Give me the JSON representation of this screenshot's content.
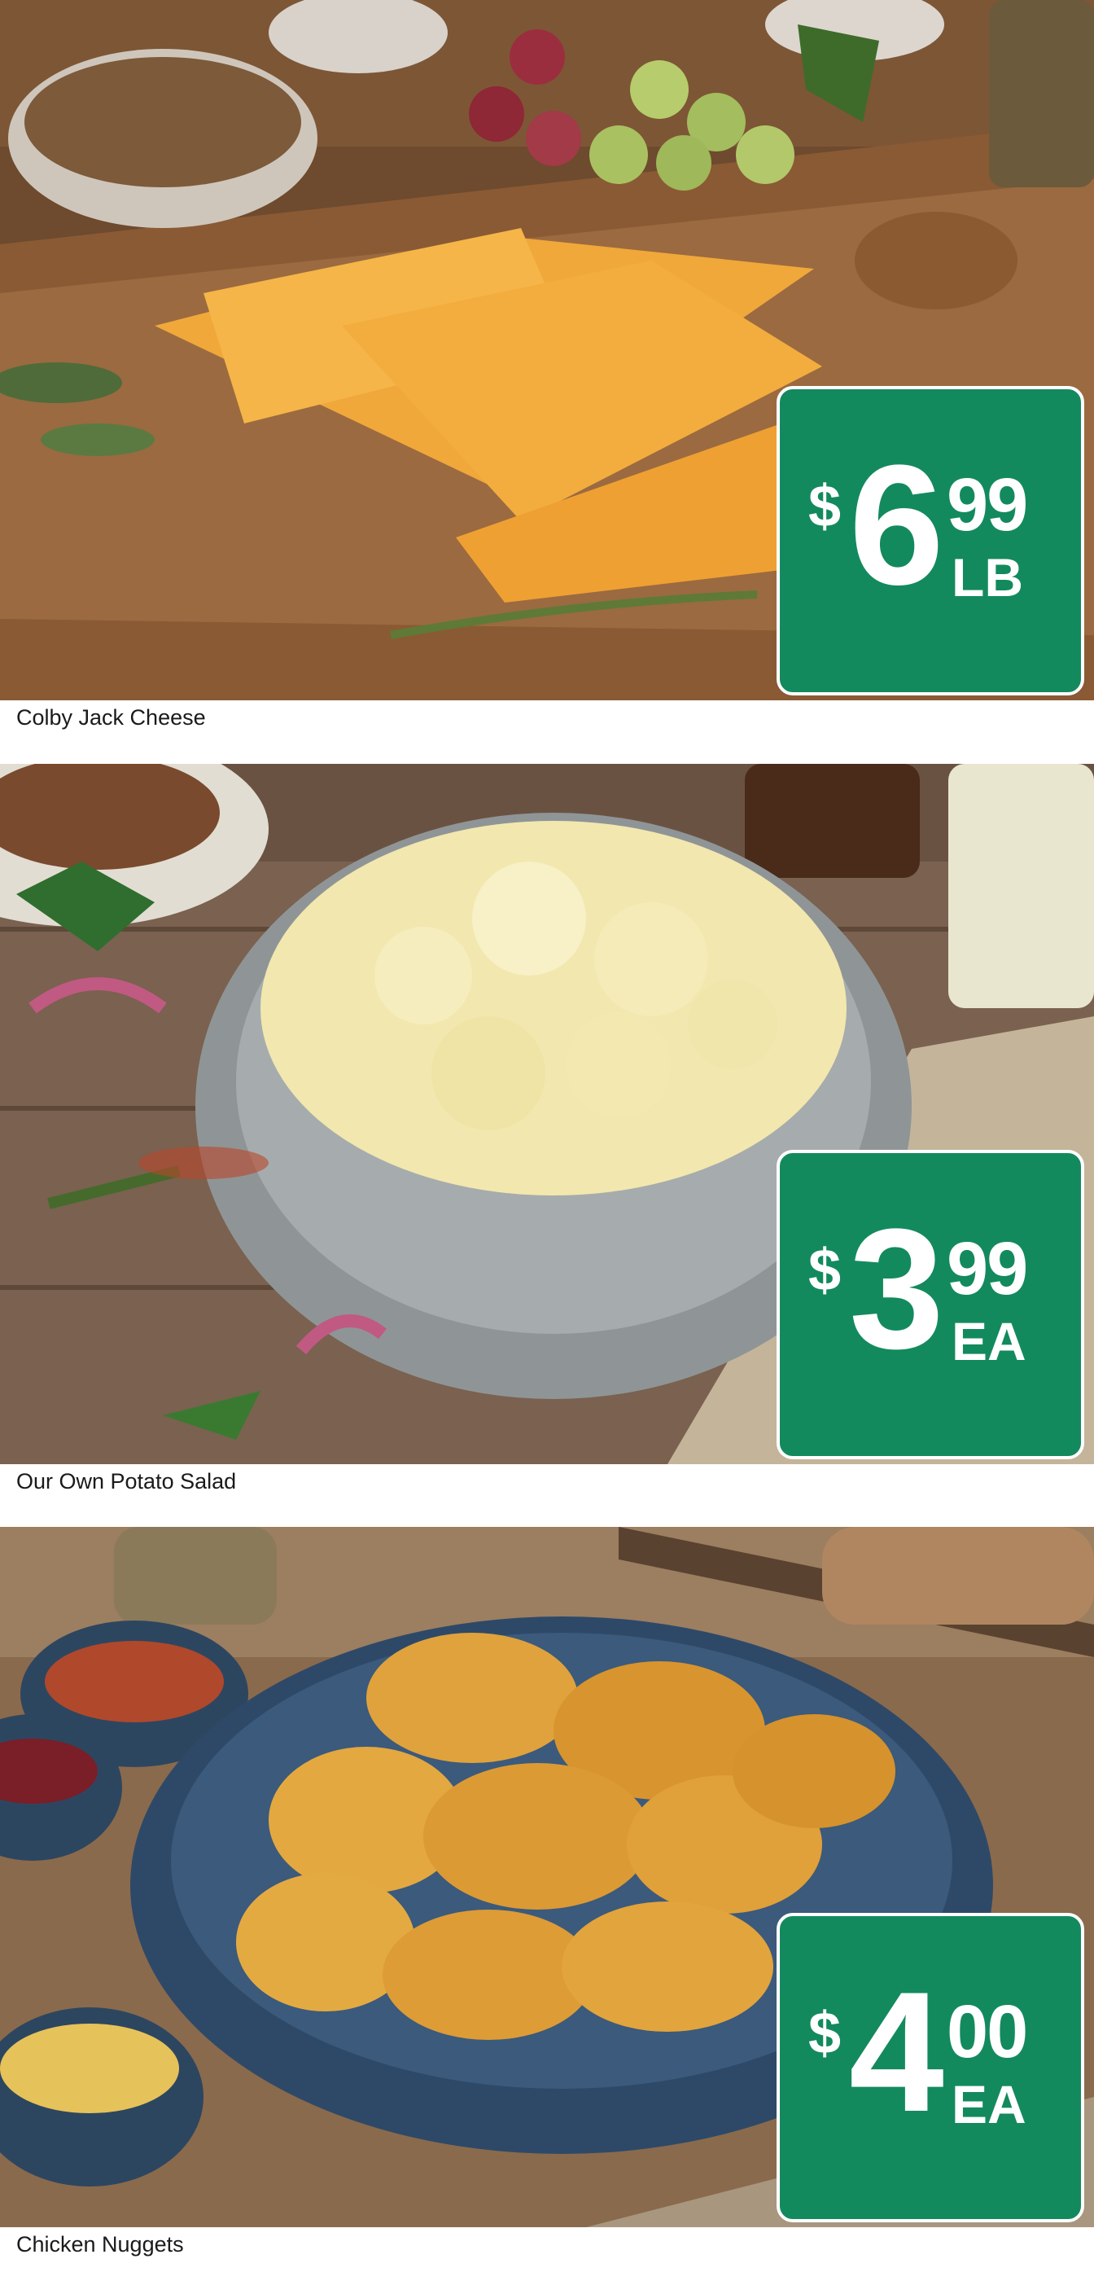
{
  "colors": {
    "price_tag_bg": "#138a5e",
    "price_tag_text": "#ffffff"
  },
  "products": [
    {
      "name": "Colby Jack Cheese",
      "price_symbol": "$",
      "price_main": "6",
      "price_cents": "99",
      "price_unit": "LB",
      "image_icon": "cheese-board-photo"
    },
    {
      "name": "Our Own Potato Salad",
      "price_symbol": "$",
      "price_main": "3",
      "price_cents": "99",
      "price_unit": "EA",
      "image_icon": "potato-salad-photo"
    },
    {
      "name": "Chicken Nuggets",
      "price_symbol": "$",
      "price_main": "4",
      "price_cents": "00",
      "price_unit": "EA",
      "image_icon": "chicken-nuggets-photo"
    }
  ]
}
